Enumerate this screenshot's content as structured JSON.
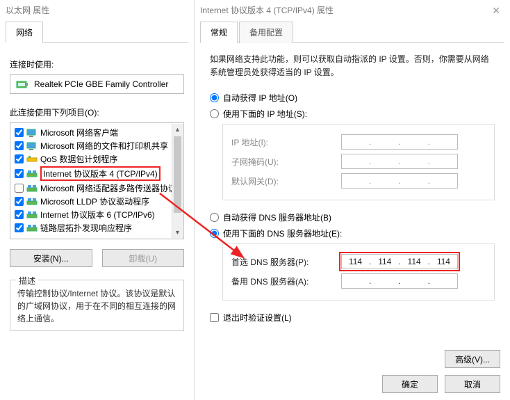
{
  "left": {
    "title": "以太网 属性",
    "tab": "网络",
    "connect_using": "连接时使用:",
    "adapter": "Realtek PCIe GBE Family Controller",
    "items_label": "此连接使用下列项目(O):",
    "items": [
      {
        "label": "Microsoft 网络客户端",
        "checked": true,
        "icon": "client"
      },
      {
        "label": "Microsoft 网络的文件和打印机共享",
        "checked": true,
        "icon": "client"
      },
      {
        "label": "QoS 数据包计划程序",
        "checked": true,
        "icon": "qos"
      },
      {
        "label": "Internet 协议版本 4 (TCP/IPv4)",
        "checked": true,
        "icon": "proto",
        "highlight": true
      },
      {
        "label": "Microsoft 网络适配器多路传送器协议",
        "checked": false,
        "icon": "proto"
      },
      {
        "label": "Microsoft LLDP 协议驱动程序",
        "checked": true,
        "icon": "proto"
      },
      {
        "label": "Internet 协议版本 6 (TCP/IPv6)",
        "checked": true,
        "icon": "proto"
      },
      {
        "label": "链路层拓扑发现响应程序",
        "checked": true,
        "icon": "proto"
      }
    ],
    "install_btn": "安装(N)...",
    "uninstall_btn": "卸载(U)",
    "desc_legend": "描述",
    "desc": "传输控制协议/Internet 协议。该协议是默认的广域网协议，用于在不同的相互连接的网络上通信。"
  },
  "right": {
    "title": "Internet 协议版本 4 (TCP/IPv4) 属性",
    "tabs": {
      "general": "常规",
      "alt": "备用配置"
    },
    "info": "如果网络支持此功能，则可以获取自动指派的 IP 设置。否则，你需要从网络系统管理员处获得适当的 IP 设置。",
    "ip_auto": "自动获得 IP 地址(O)",
    "ip_manual": "使用下面的 IP 地址(S):",
    "ip_addr_label": "IP 地址(I):",
    "subnet_label": "子网掩码(U):",
    "gateway_label": "默认网关(D):",
    "dns_auto": "自动获得 DNS 服务器地址(B)",
    "dns_manual": "使用下面的 DNS 服务器地址(E):",
    "dns_pref_label": "首选 DNS 服务器(P):",
    "dns_pref_value": [
      "114",
      "114",
      "114",
      "114"
    ],
    "dns_alt_label": "备用 DNS 服务器(A):",
    "validate": "退出时验证设置(L)",
    "advanced": "高级(V)...",
    "ok": "确定",
    "cancel": "取消"
  }
}
